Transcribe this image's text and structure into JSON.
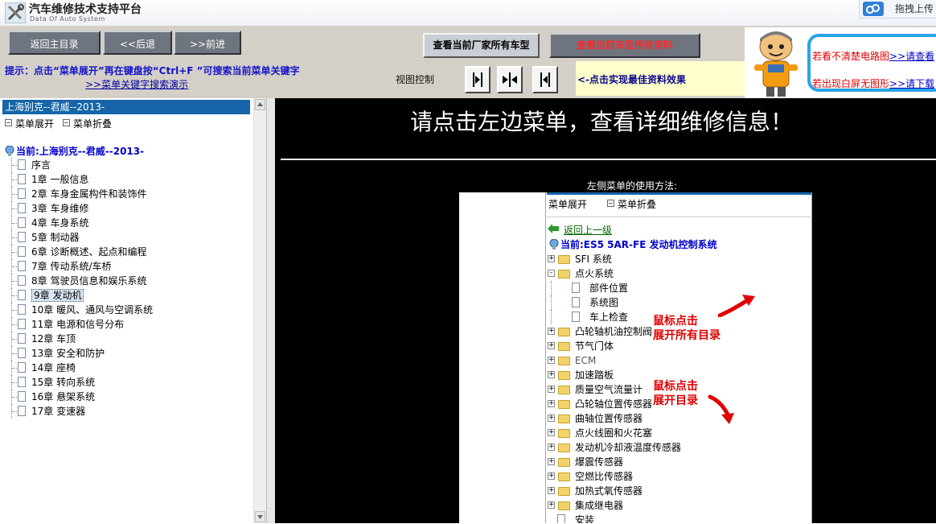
{
  "app": {
    "title": "汽车维修技术支持平台",
    "subtitle": "Data Of Auto System",
    "upload_label": "拖拽上传"
  },
  "toolbar": {
    "back_main": "返回主目录",
    "back": "<<后退",
    "forward": ">>前进",
    "all_models": "查看当前厂家所有车型",
    "all_docs": "查看当前车型所有资料",
    "hint": "提示：点击“菜单展开”再在键盘按“Ctrl+F ”可搜索当前菜单关键字",
    "search_demo": ">>菜单关键字搜索演示",
    "view_control": "视图控制",
    "best_effect": "<-点击实现最佳资料效果",
    "msg1_text": "若看不清楚电路图",
    "msg1_link": ">>请查看",
    "msg2_text": "若出现白屏无图形",
    "msg2_link": ">>请下载"
  },
  "tree": {
    "header": "上海别克--君威--2013-",
    "expand_all": "菜单展开",
    "collapse_all": "菜单折叠",
    "current": "当前:上海别克--君威--2013-",
    "items": [
      {
        "label": "序言"
      },
      {
        "label": "1章 一般信息"
      },
      {
        "label": "2章 车身金属构件和装饰件"
      },
      {
        "label": "3章 车身维修"
      },
      {
        "label": "4章 车身系统"
      },
      {
        "label": "5章 制动器"
      },
      {
        "label": "6章 诊断概述、起点和编程"
      },
      {
        "label": "7章 传动系统/车桥"
      },
      {
        "label": "8章 驾驶员信息和娱乐系统"
      },
      {
        "label": "9章 发动机"
      },
      {
        "label": "10章 暖风、通风与空调系统"
      },
      {
        "label": "11章 电源和信号分布"
      },
      {
        "label": "12章 车顶"
      },
      {
        "label": "13章 安全和防护"
      },
      {
        "label": "14章 座椅"
      },
      {
        "label": "15章 转向系统"
      },
      {
        "label": "16章 悬架系统"
      },
      {
        "label": "17章 变速器"
      }
    ],
    "selected_index": 9
  },
  "main": {
    "heading": "请点击左边菜单，查看详细维修信息！",
    "usage_title": "左侧菜单的使用方法:"
  },
  "demo": {
    "expand": "菜单展开",
    "collapse": "菜单折叠",
    "back": "返回上一级",
    "current": "当前:ES5 5AR-FE 发动机控制系统",
    "annotation1": [
      "鼠标点击",
      "展开所有目录"
    ],
    "annotation2": [
      "鼠标点击",
      "展开目录"
    ],
    "items": [
      {
        "label": "SFI 系统",
        "type": "folder",
        "state": "+"
      },
      {
        "label": "点火系统",
        "type": "folder",
        "state": "-"
      },
      {
        "label": "部件位置",
        "type": "doc"
      },
      {
        "label": "系统图",
        "type": "doc"
      },
      {
        "label": "车上检查",
        "type": "doc"
      },
      {
        "label": "凸轮轴机油控制阀",
        "type": "folder",
        "state": "+"
      },
      {
        "label": "节气门体",
        "type": "folder",
        "state": "+"
      },
      {
        "label": "ECM",
        "type": "folder",
        "state": "+"
      },
      {
        "label": "加速踏板",
        "type": "folder",
        "state": "+"
      },
      {
        "label": "质量空气流量计",
        "type": "folder",
        "state": "+"
      },
      {
        "label": "凸轮轴位置传感器",
        "type": "folder",
        "state": "+"
      },
      {
        "label": "曲轴位置传感器",
        "type": "folder",
        "state": "+"
      },
      {
        "label": "点火线圈和火花塞",
        "type": "folder",
        "state": "+"
      },
      {
        "label": "发动机冷却液温度传感器",
        "type": "folder",
        "state": "+"
      },
      {
        "label": "爆震传感器",
        "type": "folder",
        "state": "+"
      },
      {
        "label": "空燃比传感器",
        "type": "folder",
        "state": "+"
      },
      {
        "label": "加热式氧传感器",
        "type": "folder",
        "state": "+"
      },
      {
        "label": "集成继电器",
        "type": "folder",
        "state": "+"
      },
      {
        "label": "安装",
        "type": "doc_root"
      }
    ]
  },
  "colors": {
    "accent": "#1565a8",
    "hint_text": "#1414c8",
    "alert_red": "#e00000"
  }
}
